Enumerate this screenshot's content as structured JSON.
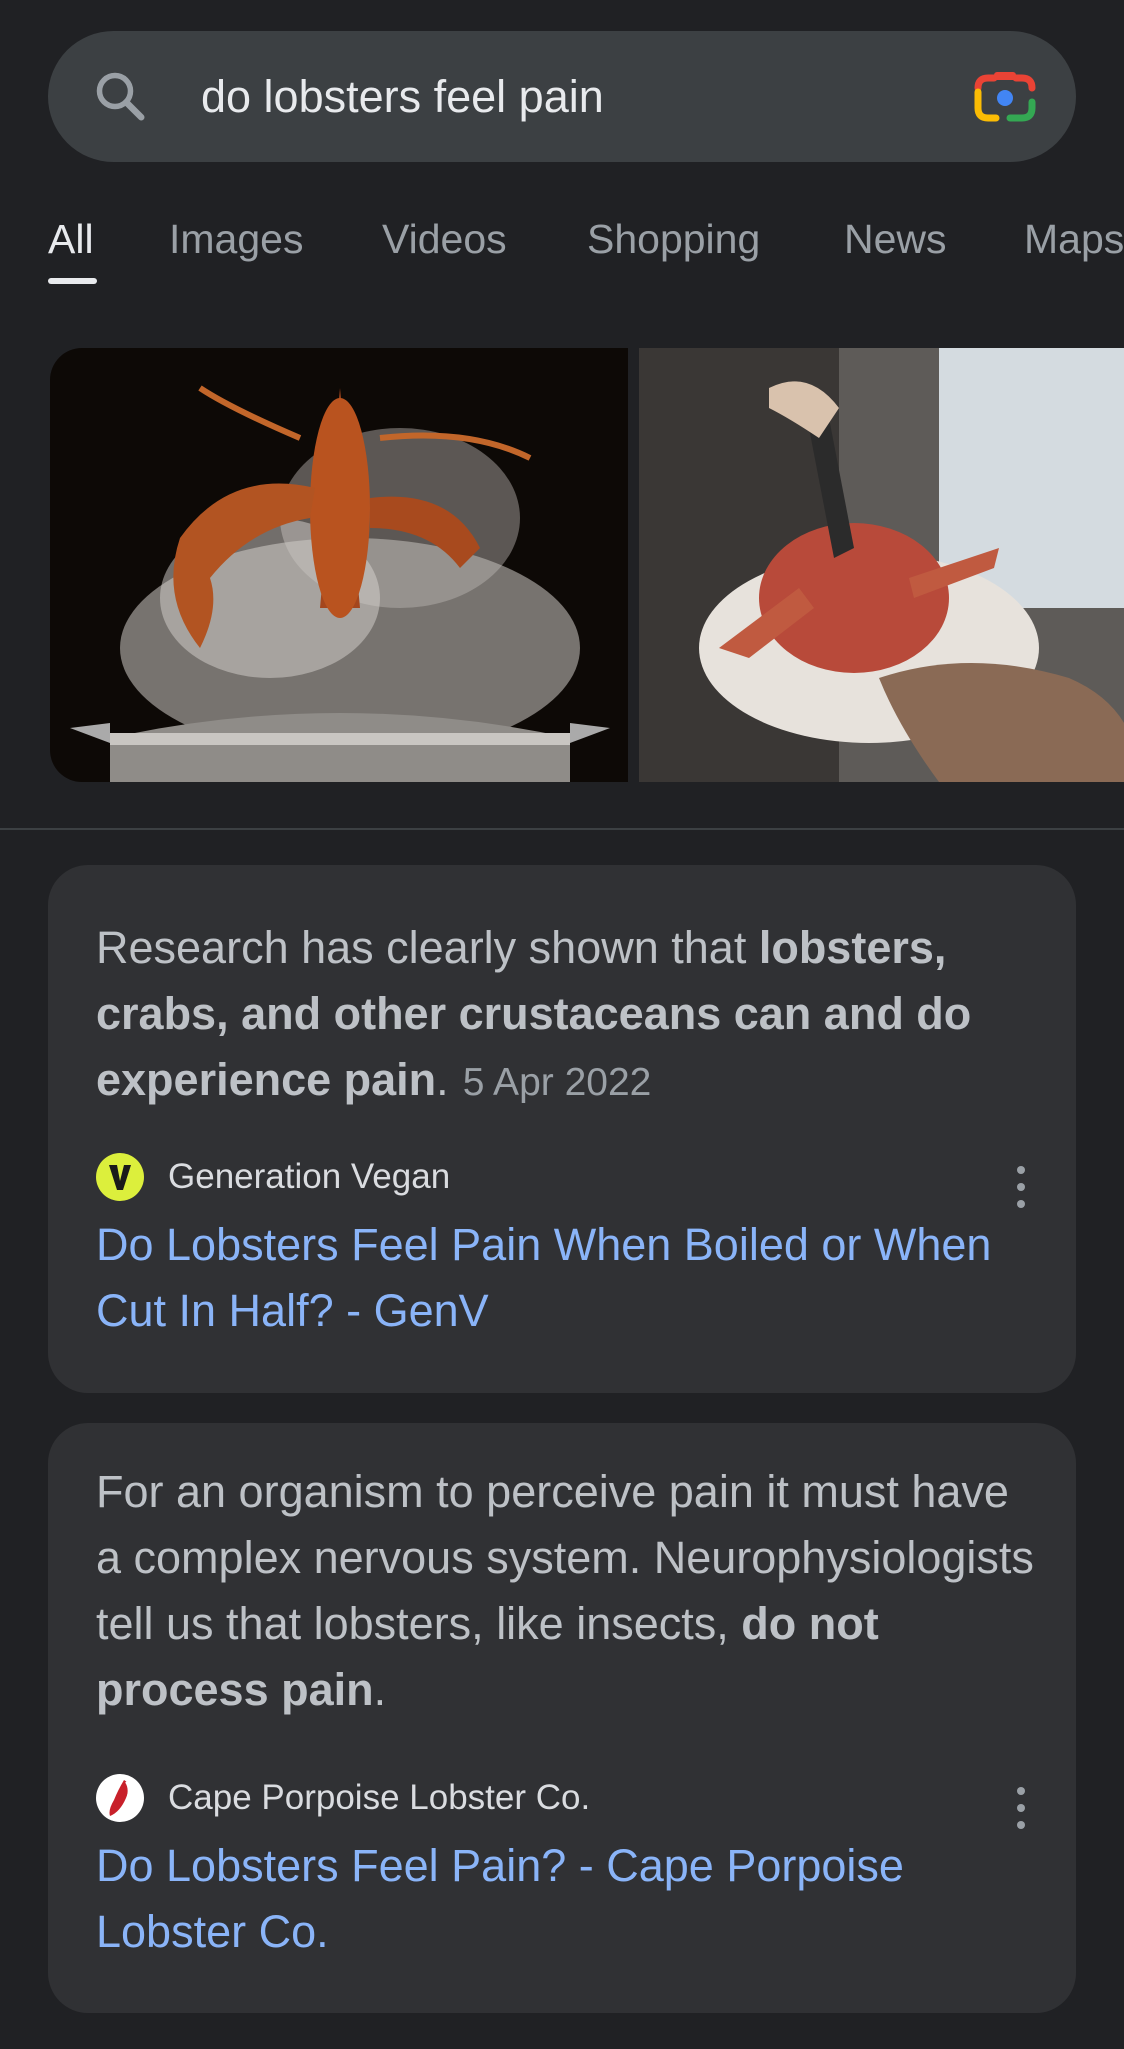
{
  "search": {
    "query": "do lobsters feel pain",
    "icon": "search-icon",
    "lens_icon": "google-lens-icon"
  },
  "tabs": [
    {
      "label": "All",
      "active": true
    },
    {
      "label": "Images",
      "active": false
    },
    {
      "label": "Videos",
      "active": false
    },
    {
      "label": "Shopping",
      "active": false
    },
    {
      "label": "News",
      "active": false
    },
    {
      "label": "Maps",
      "active": false
    }
  ],
  "results": [
    {
      "snippet_plain_1": "Research has clearly shown that ",
      "snippet_bold_1": "lobsters, crabs, and other crustaceans can and do experience pain",
      "snippet_plain_2": ".",
      "date": "5 Apr 2022",
      "source": "Generation Vegan",
      "favicon": "generation-vegan-logo",
      "title": "Do Lobsters Feel Pain When Boiled or When Cut In Half? - GenV"
    },
    {
      "snippet_plain_1": "For an organism to perceive pain it must have a complex nervous system. Neurophysiologists tell us that lobsters, like insects, ",
      "snippet_bold_1": "do not process pain",
      "snippet_plain_2": ".",
      "source": "Cape Porpoise Lobster Co.",
      "favicon": "cape-porpoise-logo",
      "title": "Do Lobsters Feel Pain? - Cape Porpoise Lobster Co."
    }
  ],
  "colors": {
    "background": "#202124",
    "card": "#303134",
    "link": "#8ab4f8",
    "text": "#bdc1c6"
  }
}
